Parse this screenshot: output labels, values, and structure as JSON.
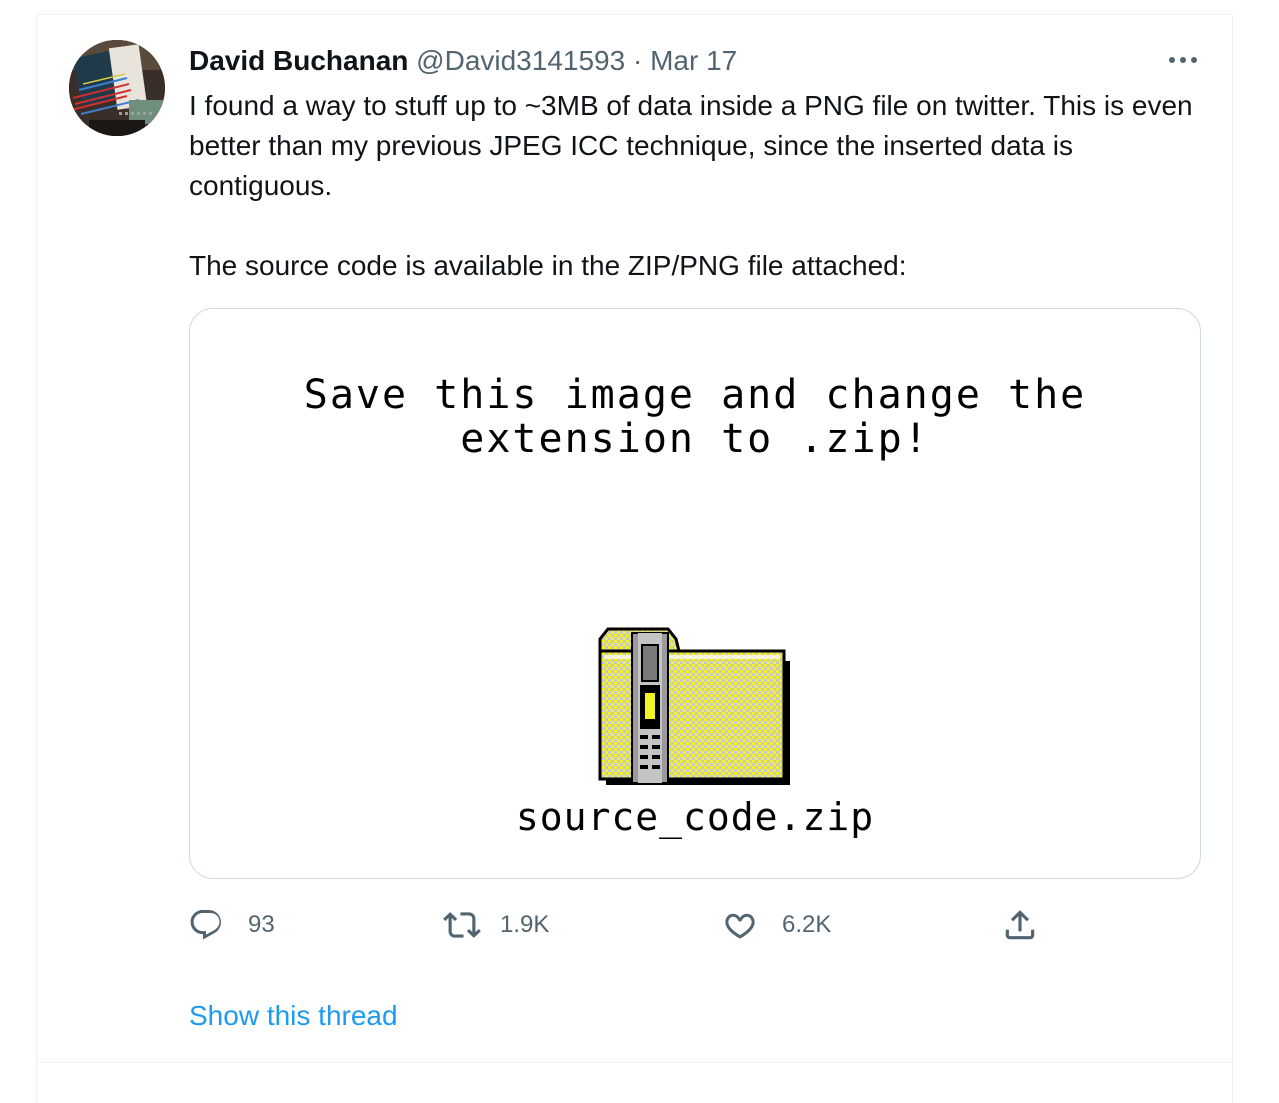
{
  "tweet": {
    "author_name": "David Buchanan",
    "author_handle": "@David3141593",
    "separator": "·",
    "date": "Mar 17",
    "text_paragraph_1": "I found a way to stuff up to ~3MB of data inside a PNG file on twitter. This is even better than my previous JPEG ICC technique, since the inserted data is contiguous.",
    "text_paragraph_2": "The source code is available in the ZIP/PNG file attached:",
    "more_icon": "more-horizontal-icon"
  },
  "media": {
    "heading_line_1": "Save this image and change the",
    "heading_line_2": "extension to .zip!",
    "filename": "source_code.zip",
    "icon": "zip-folder-icon",
    "folder_color": "#f2f224",
    "zipper_color": "#8a8a8a"
  },
  "actions": {
    "reply": {
      "icon": "reply-icon",
      "count": "93"
    },
    "retweet": {
      "icon": "retweet-icon",
      "count": "1.9K"
    },
    "like": {
      "icon": "heart-icon",
      "count": "6.2K"
    },
    "share": {
      "icon": "share-icon"
    }
  },
  "show_thread_label": "Show this thread",
  "colors": {
    "text_primary": "#0f1419",
    "text_secondary": "#536471",
    "link": "#1d9bf0",
    "border": "#cfd9de"
  }
}
